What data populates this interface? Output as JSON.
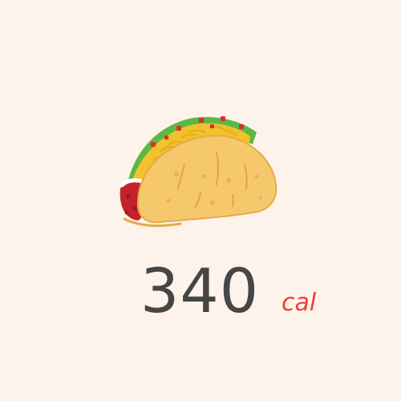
{
  "calorie_card": {
    "food_icon": "taco-icon",
    "calories_value": "340",
    "calories_unit": "cal"
  },
  "colors": {
    "background": "#fef3ea",
    "value_text": "#464646",
    "unit_text": "#e8403a",
    "shell": "#f5c96b",
    "cheese": "#f2c12e",
    "lettuce": "#5bb843",
    "meat": "#c4222b"
  }
}
